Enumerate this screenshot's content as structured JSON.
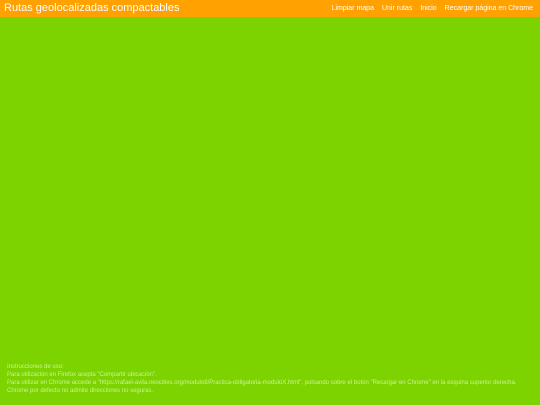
{
  "header": {
    "title": "Rutas geolocalizadas compactables",
    "nav": [
      {
        "label": "Limpiar mapa"
      },
      {
        "label": "Unir rutas"
      },
      {
        "label": "Inicio"
      },
      {
        "label": "Recargar página en Chrome"
      }
    ]
  },
  "colors": {
    "header_background": "#ffa100",
    "map_background": "#7dd300",
    "instructions_text": "#c7f58f"
  },
  "instructions": {
    "heading": "Instrucciones de uso:",
    "line1": "Para utilización en Firefox acepta \"Compartir ubicación\".",
    "line2": "Para utilizar en Chrome accede a \"https://rafael-avila.neocities.org/modulo8/Practica-obligatoria-moduloX.html\", pulsando sobre el botón \"Recargar en Chrome\" en la esquina superior derecha. Chrome por defecto no admite direcciones no seguras."
  }
}
